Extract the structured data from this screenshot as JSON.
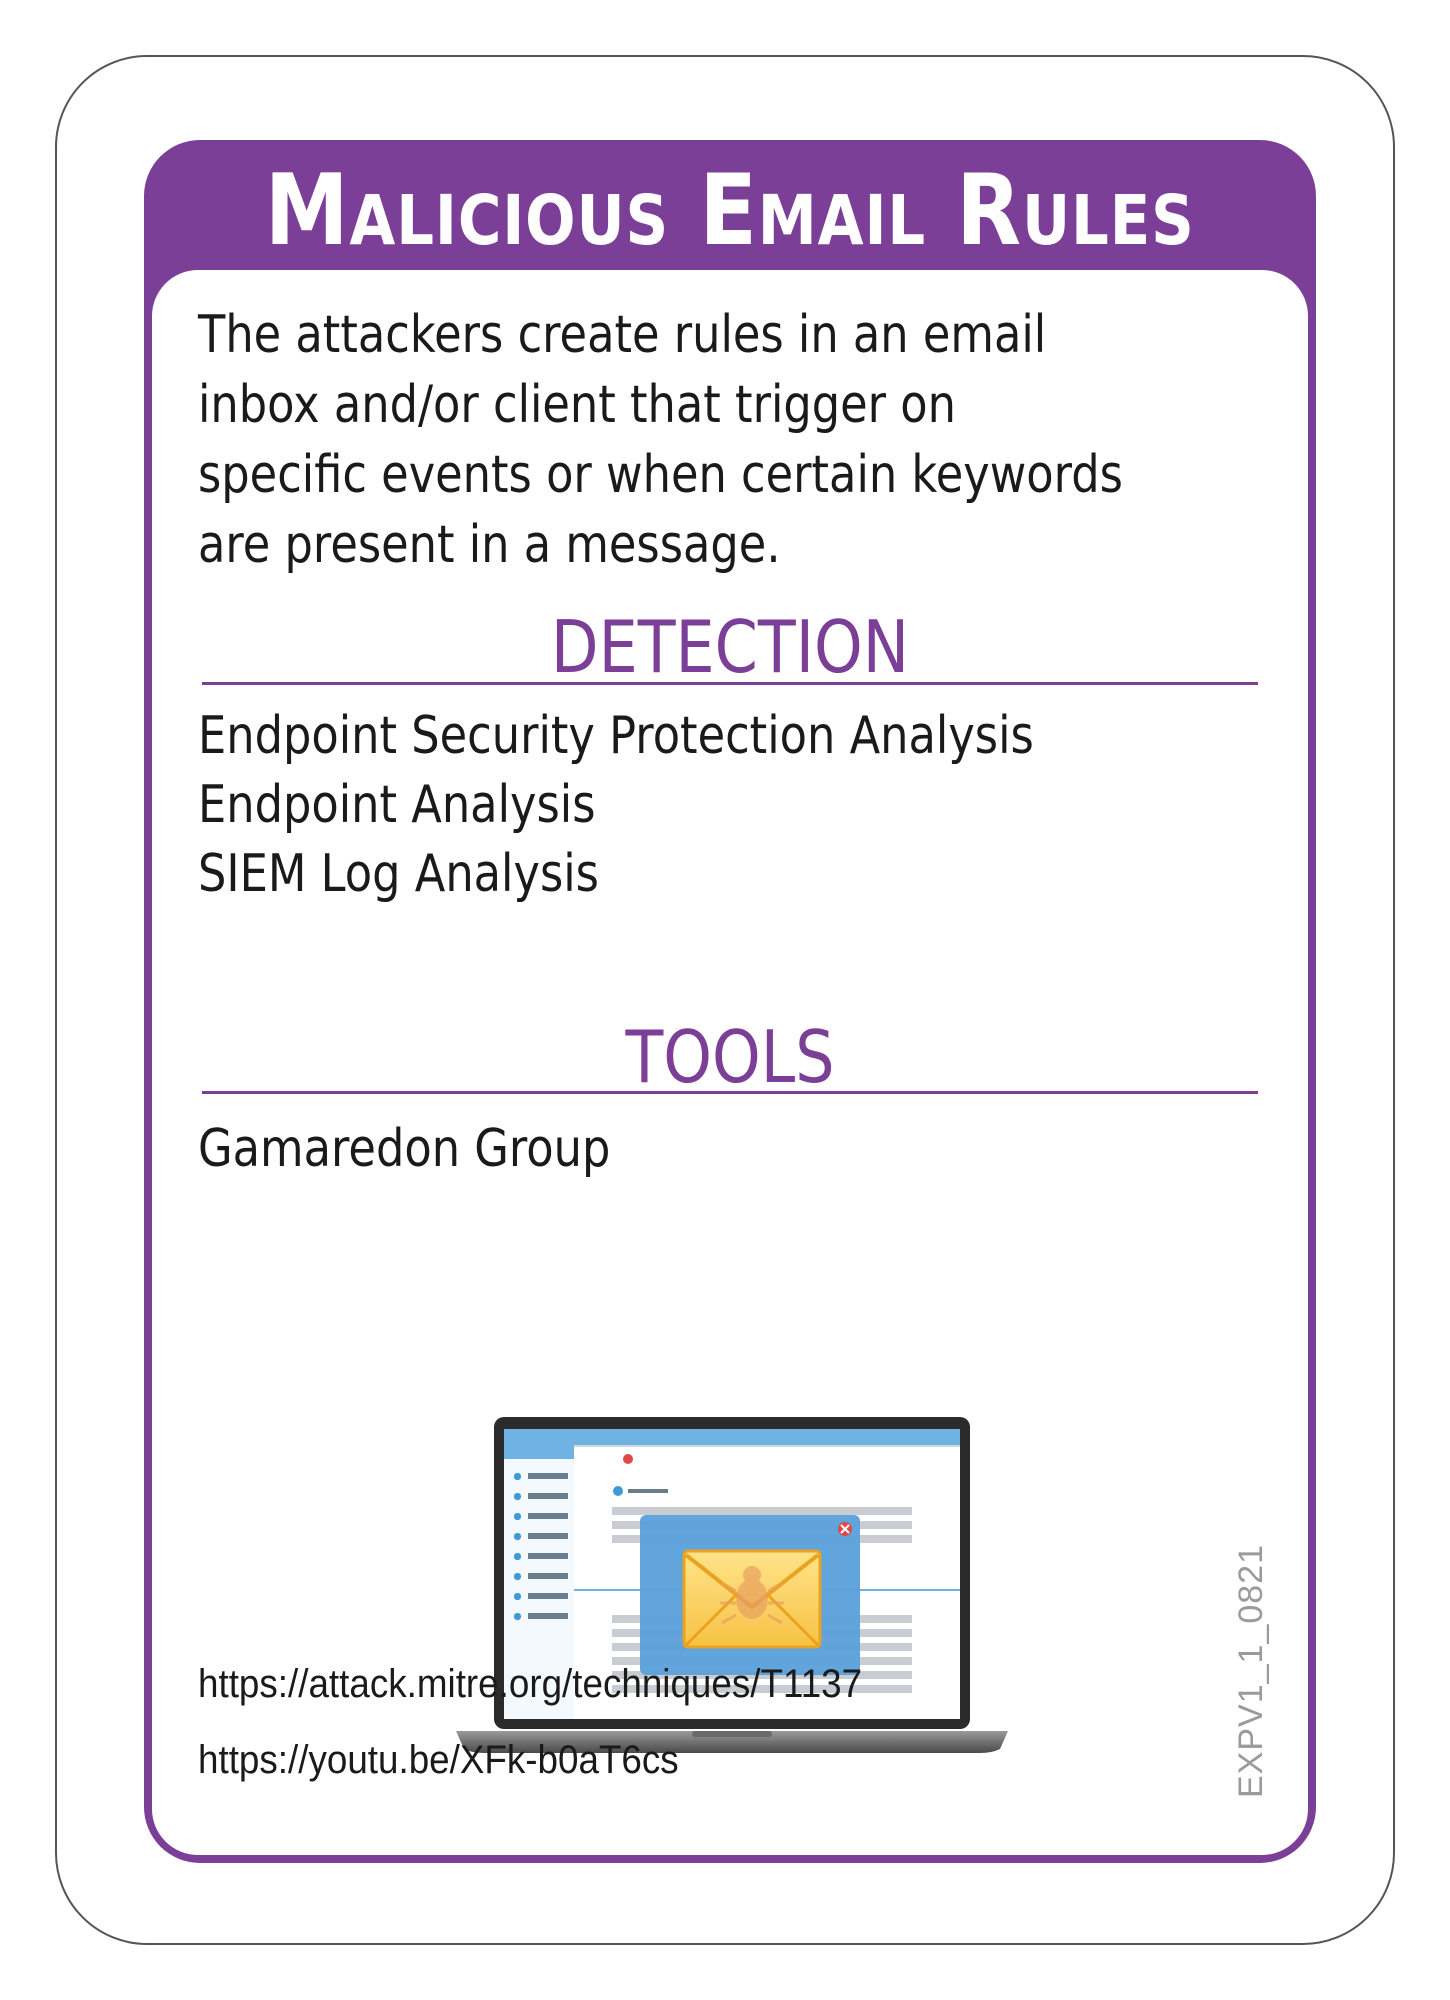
{
  "card": {
    "title": "Malicious Email Rules",
    "description": "The attackers create rules in an email inbox and/or client that trigger on specific events or when certain keywords are present in a message.",
    "detection": {
      "heading": "DETECTION",
      "items": [
        "Endpoint Security Protection Analysis",
        "Endpoint Analysis",
        "SIEM Log Analysis"
      ]
    },
    "tools": {
      "heading": "TOOLS",
      "items": [
        "Gamaredon Group"
      ]
    },
    "links": [
      "https://attack.mitre.org/techniques/T1137",
      "https://youtu.be/XFk-b0aT6cs"
    ],
    "card_code": "EXPV1_1_0821",
    "illustration": "laptop-email-bug-icon",
    "colors": {
      "accent": "#7b3f98",
      "text": "#1a1a1a",
      "code": "#9a9a9a"
    }
  }
}
